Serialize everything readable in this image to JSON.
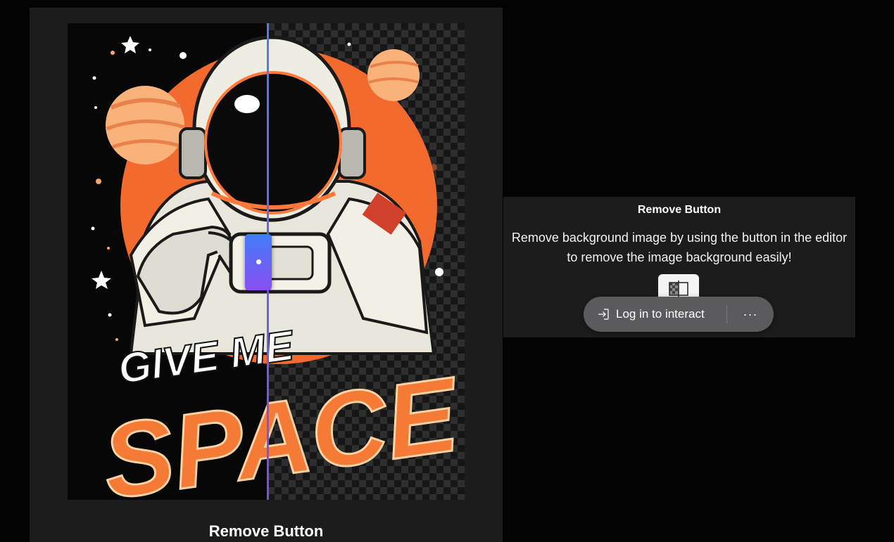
{
  "left_card": {
    "artwork": {
      "line1": "GIVE ME",
      "line2": "SPACE"
    },
    "caption": "Remove Button"
  },
  "right_card": {
    "title": "Remove Button",
    "description": "Remove background image by using the button in the editor to remove the image background easily!",
    "tool_icon": "remove-background-icon",
    "login_label": "Log in to interact",
    "login_icon": "login-arrow-icon",
    "more_label": "···"
  },
  "colors": {
    "accent_blue": "#4f7cf5",
    "accent_purple": "#8a4ef0",
    "orange": "#f26a2e",
    "card_bg": "#1c1c1d"
  }
}
